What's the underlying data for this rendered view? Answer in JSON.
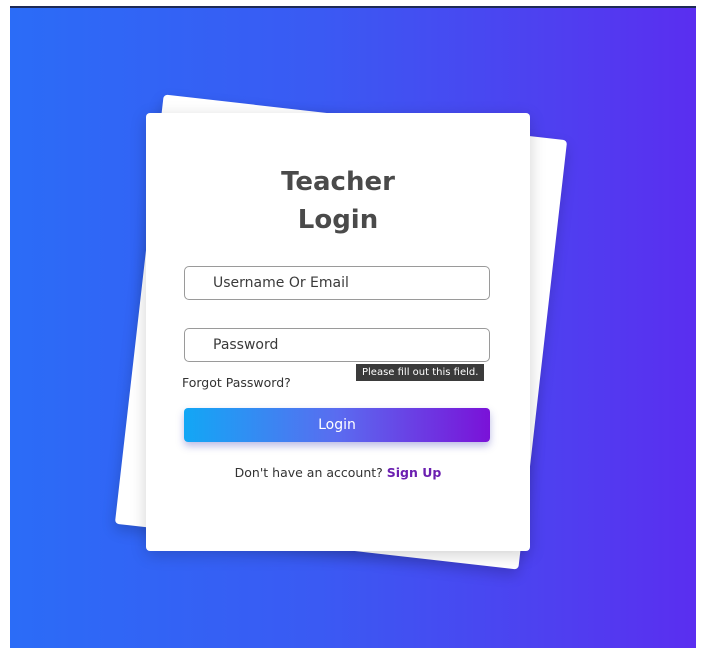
{
  "login": {
    "title_line1": "Teacher",
    "title_line2": "Login",
    "username_placeholder": "Username Or Email",
    "password_placeholder": "Password",
    "validation_tooltip": "Please fill out this field.",
    "forgot_password": "Forgot Password?",
    "login_button": "Login",
    "signup_prompt": "Don't have an account?",
    "signup_link": "Sign Up"
  },
  "colors": {
    "background_start": "#2b6cf7",
    "background_end": "#5a2ef0",
    "button_start": "#12a7f5",
    "button_end": "#7a12d8",
    "signup_link": "#6b1fb0",
    "title": "#4a4a4a"
  }
}
